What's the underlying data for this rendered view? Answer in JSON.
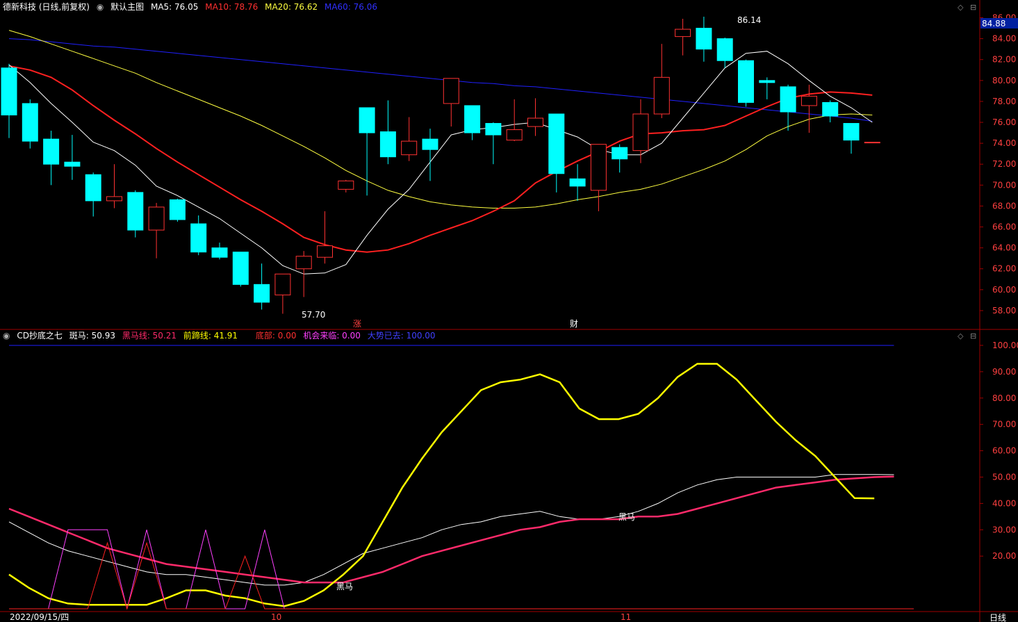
{
  "header": {
    "stock_title": "德新科技 (日线,前复权)",
    "main_chart_label": "默认主图",
    "ma5": "MA5: 76.05",
    "ma10": "MA10: 78.76",
    "ma20": "MA20: 76.62",
    "ma60": "MA60: 76.06"
  },
  "indicator_header": {
    "name": "CD抄底之七",
    "banma": "斑马: 50.93",
    "heima": "黑马线: 50.21",
    "qianti": "前蹄线: 41.91",
    "dibu": "底部: 0.00",
    "jihui": "机会来临: 0.00",
    "dapan": "大势已去: 100.00"
  },
  "colors": {
    "up": "#ff3232",
    "down": "#00ffff",
    "ma5": "#ffffff",
    "ma10": "#ff2020",
    "ma20": "#ffff40",
    "ma60": "#2020ff",
    "banma": "#ffffff",
    "heima": "#ff2a6a",
    "qianti": "#ffff00",
    "jihui": "#ff40ff",
    "dibu": "#ff2020",
    "dapan": "#2020ff",
    "frame": "#a00000"
  },
  "footer": {
    "date": "2022/09/15/四",
    "month_oct": "10",
    "month_nov": "11",
    "period": "日线"
  },
  "annotations": {
    "high_label": "86.14",
    "low_label": "57.70",
    "mark_zhang": "涨",
    "mark_cai": "财",
    "heima_text_1": "黑马",
    "heima_text_2": "黑马"
  },
  "chart_data": [
    {
      "type": "candlestick",
      "title": "德新科技 (日线,前复权)",
      "ylim": [
        57,
        86.5
      ],
      "yticks": [
        58,
        60,
        62,
        64,
        66,
        68,
        70,
        72,
        74,
        76,
        78,
        80,
        82,
        84,
        86
      ],
      "current_price_label": "84.88",
      "candles": [
        {
          "o": 81.2,
          "h": 81.6,
          "c": 76.7,
          "l": 74.5
        },
        {
          "o": 77.8,
          "h": 78.2,
          "c": 74.2,
          "l": 73.5
        },
        {
          "o": 74.4,
          "h": 75.2,
          "c": 72.0,
          "l": 70.0
        },
        {
          "o": 72.2,
          "h": 74.8,
          "c": 71.8,
          "l": 70.5
        },
        {
          "o": 71.0,
          "h": 71.2,
          "c": 68.5,
          "l": 67.0
        },
        {
          "o": 68.5,
          "h": 72.0,
          "c": 68.9,
          "l": 67.8
        },
        {
          "o": 69.3,
          "h": 69.5,
          "c": 65.7,
          "l": 65.0
        },
        {
          "o": 65.7,
          "h": 68.3,
          "c": 67.9,
          "l": 63.0
        },
        {
          "o": 68.6,
          "h": 68.7,
          "c": 66.7,
          "l": 66.5
        },
        {
          "o": 66.3,
          "h": 67.1,
          "c": 63.6,
          "l": 63.3
        },
        {
          "o": 64.0,
          "h": 64.5,
          "c": 63.1,
          "l": 62.9
        },
        {
          "o": 63.6,
          "h": 63.6,
          "c": 60.5,
          "l": 60.3
        },
        {
          "o": 60.5,
          "h": 62.5,
          "c": 58.8,
          "l": 58.1
        },
        {
          "o": 59.5,
          "h": 61.5,
          "c": 61.5,
          "l": 57.7
        },
        {
          "o": 62.0,
          "h": 63.7,
          "c": 63.2,
          "l": 59.3
        },
        {
          "o": 63.1,
          "h": 67.5,
          "c": 64.2,
          "l": 62.5
        },
        {
          "o": 69.6,
          "h": 70.5,
          "c": 70.4,
          "l": 69.3
        },
        {
          "o": 77.4,
          "h": 77.4,
          "c": 75.0,
          "l": 69.0
        },
        {
          "o": 75.1,
          "h": 78.1,
          "c": 72.7,
          "l": 72.0
        },
        {
          "o": 72.9,
          "h": 76.5,
          "c": 74.2,
          "l": 72.3
        },
        {
          "o": 74.4,
          "h": 75.4,
          "c": 73.4,
          "l": 70.4
        },
        {
          "o": 77.8,
          "h": 80.0,
          "c": 80.2,
          "l": 75.6
        },
        {
          "o": 77.6,
          "h": 77.6,
          "c": 75.0,
          "l": 74.3
        },
        {
          "o": 75.9,
          "h": 76.0,
          "c": 74.8,
          "l": 72.0
        },
        {
          "o": 74.3,
          "h": 78.2,
          "c": 75.3,
          "l": 74.2
        },
        {
          "o": 75.6,
          "h": 78.3,
          "c": 76.4,
          "l": 74.7
        },
        {
          "o": 76.8,
          "h": 76.8,
          "c": 71.1,
          "l": 69.3
        },
        {
          "o": 70.6,
          "h": 72.0,
          "c": 69.9,
          "l": 68.5
        },
        {
          "o": 69.5,
          "h": 73.9,
          "c": 73.9,
          "l": 67.5
        },
        {
          "o": 73.6,
          "h": 73.9,
          "c": 72.5,
          "l": 71.2
        },
        {
          "o": 73.3,
          "h": 78.2,
          "c": 76.8,
          "l": 72.1
        },
        {
          "o": 76.8,
          "h": 83.5,
          "c": 80.3,
          "l": 76.4
        },
        {
          "o": 84.2,
          "h": 85.9,
          "c": 84.9,
          "l": 82.4
        },
        {
          "o": 85.0,
          "h": 86.1,
          "c": 83.0,
          "l": 81.8
        },
        {
          "o": 84.0,
          "h": 84.1,
          "c": 81.9,
          "l": 81.2
        },
        {
          "o": 81.9,
          "h": 82.0,
          "c": 77.9,
          "l": 77.5
        },
        {
          "o": 80.0,
          "h": 80.3,
          "c": 79.8,
          "l": 78.2
        },
        {
          "o": 79.4,
          "h": 79.6,
          "c": 77.0,
          "l": 75.2
        },
        {
          "o": 77.6,
          "h": 79.6,
          "c": 78.5,
          "l": 75.0
        },
        {
          "o": 77.9,
          "h": 78.1,
          "c": 76.6,
          "l": 76.0
        },
        {
          "o": 75.9,
          "h": 75.9,
          "c": 74.3,
          "l": 73.0
        },
        {
          "o": 74.1,
          "h": 74.1,
          "c": 74.1,
          "l": 74.1
        }
      ],
      "ma5": [
        81.5,
        79.8,
        77.8,
        76.0,
        74.1,
        73.3,
        71.9,
        69.9,
        69.0,
        67.9,
        66.8,
        65.4,
        64.0,
        62.3,
        61.5,
        61.6,
        62.4,
        65.2,
        67.7,
        69.6,
        72.2,
        74.8,
        75.3,
        75.5,
        75.8,
        76.0,
        75.3,
        74.6,
        73.4,
        72.9,
        72.9,
        74.0,
        76.4,
        78.8,
        81.2,
        82.6,
        82.8,
        81.6,
        80.0,
        78.5,
        77.4,
        76.0
      ],
      "ma10": [
        81.4,
        81.0,
        80.3,
        79.1,
        77.6,
        76.2,
        74.9,
        73.5,
        72.2,
        71.0,
        69.8,
        68.6,
        67.5,
        66.3,
        65.0,
        64.3,
        63.8,
        63.6,
        63.8,
        64.4,
        65.2,
        65.9,
        66.6,
        67.5,
        68.5,
        70.2,
        71.3,
        72.3,
        73.2,
        74.2,
        74.9,
        75.0,
        75.2,
        75.3,
        75.7,
        76.6,
        77.5,
        78.3,
        78.7,
        78.9,
        78.8,
        78.6
      ],
      "ma20": [
        84.8,
        84.2,
        83.5,
        82.8,
        82.1,
        81.4,
        80.7,
        79.8,
        79.0,
        78.2,
        77.4,
        76.6,
        75.7,
        74.7,
        73.7,
        72.6,
        71.4,
        70.4,
        69.5,
        68.9,
        68.4,
        68.1,
        67.9,
        67.8,
        67.8,
        67.9,
        68.2,
        68.6,
        68.9,
        69.3,
        69.6,
        70.1,
        70.8,
        71.5,
        72.3,
        73.4,
        74.7,
        75.6,
        76.3,
        76.7,
        76.8,
        76.7
      ],
      "ma60": [
        84.0,
        83.9,
        83.7,
        83.5,
        83.3,
        83.2,
        83.0,
        82.8,
        82.6,
        82.4,
        82.2,
        82.0,
        81.8,
        81.6,
        81.4,
        81.2,
        81.0,
        80.8,
        80.6,
        80.4,
        80.2,
        80.0,
        79.8,
        79.7,
        79.5,
        79.4,
        79.2,
        79.0,
        78.8,
        78.6,
        78.4,
        78.2,
        78.0,
        77.8,
        77.6,
        77.4,
        77.2,
        77.0,
        76.8,
        76.6,
        76.4,
        76.1
      ]
    },
    {
      "type": "line",
      "title": "CD抄底之七",
      "ylim": [
        0,
        105
      ],
      "yticks": [
        20,
        30,
        40,
        50,
        60,
        70,
        80,
        90,
        100
      ],
      "series": [
        {
          "name": "斑马",
          "values": [
            33,
            29,
            25,
            22,
            20,
            18,
            16,
            14,
            13,
            13,
            12,
            11,
            10,
            9,
            9,
            10,
            13,
            17,
            21,
            23,
            25,
            27,
            30,
            32,
            33,
            35,
            36,
            37,
            35,
            34,
            34,
            35,
            37,
            40,
            44,
            47,
            49,
            50,
            50,
            50,
            50,
            50,
            51,
            51,
            51,
            50.93
          ]
        },
        {
          "name": "黑马线",
          "values": [
            38,
            35,
            32,
            29,
            26,
            23,
            21,
            19,
            17,
            16,
            15,
            14,
            13,
            12,
            11,
            10,
            10,
            10,
            12,
            14,
            17,
            20,
            22,
            24,
            26,
            28,
            30,
            31,
            33,
            34,
            34,
            34,
            35,
            35,
            36,
            38,
            40,
            42,
            44,
            46,
            47,
            48,
            49,
            49.5,
            50,
            50.21
          ]
        },
        {
          "name": "前蹄线",
          "values": [
            13,
            8,
            4,
            2,
            1.5,
            1.5,
            1.5,
            1.5,
            4,
            7,
            7,
            5,
            4,
            2,
            1,
            3,
            7,
            13,
            20,
            33,
            46,
            57,
            67,
            75,
            83,
            86,
            87,
            89,
            86,
            76,
            72,
            72,
            74,
            80,
            88,
            93,
            93,
            87,
            79,
            71,
            64,
            58,
            50,
            42,
            41.91
          ]
        },
        {
          "name": "机会来临",
          "values": [
            0,
            0,
            0,
            30,
            30,
            30,
            0,
            30,
            0,
            0,
            30,
            0,
            0,
            30,
            0,
            0,
            0,
            0,
            0,
            0,
            0,
            0,
            0,
            0,
            0,
            0,
            0,
            0,
            0,
            0,
            0,
            0,
            0,
            0,
            0,
            0,
            0,
            0,
            0,
            0,
            0,
            0,
            0,
            0,
            0,
            0,
            0
          ]
        },
        {
          "name": "底部",
          "values": [
            0,
            0,
            0,
            0,
            0,
            25,
            0,
            25,
            0,
            0,
            0,
            0,
            20,
            0,
            0,
            0,
            0,
            0,
            0,
            0,
            0,
            0,
            0,
            0,
            0,
            0,
            0,
            0,
            0,
            0,
            0,
            0,
            0,
            0,
            0,
            0,
            0,
            0,
            0,
            0,
            0,
            0,
            0,
            0,
            0,
            0,
            0
          ]
        },
        {
          "name": "大势已去",
          "values": [
            100,
            100,
            100,
            100,
            100,
            100,
            100,
            100,
            100,
            100,
            100,
            100,
            100,
            100,
            100,
            100,
            100,
            100,
            100,
            100,
            100,
            100,
            100,
            100,
            100,
            100,
            100,
            100,
            100,
            100,
            100,
            100,
            100,
            100,
            100,
            100,
            100,
            100,
            100,
            100,
            100,
            100,
            100,
            100,
            100,
            100
          ]
        }
      ]
    }
  ]
}
